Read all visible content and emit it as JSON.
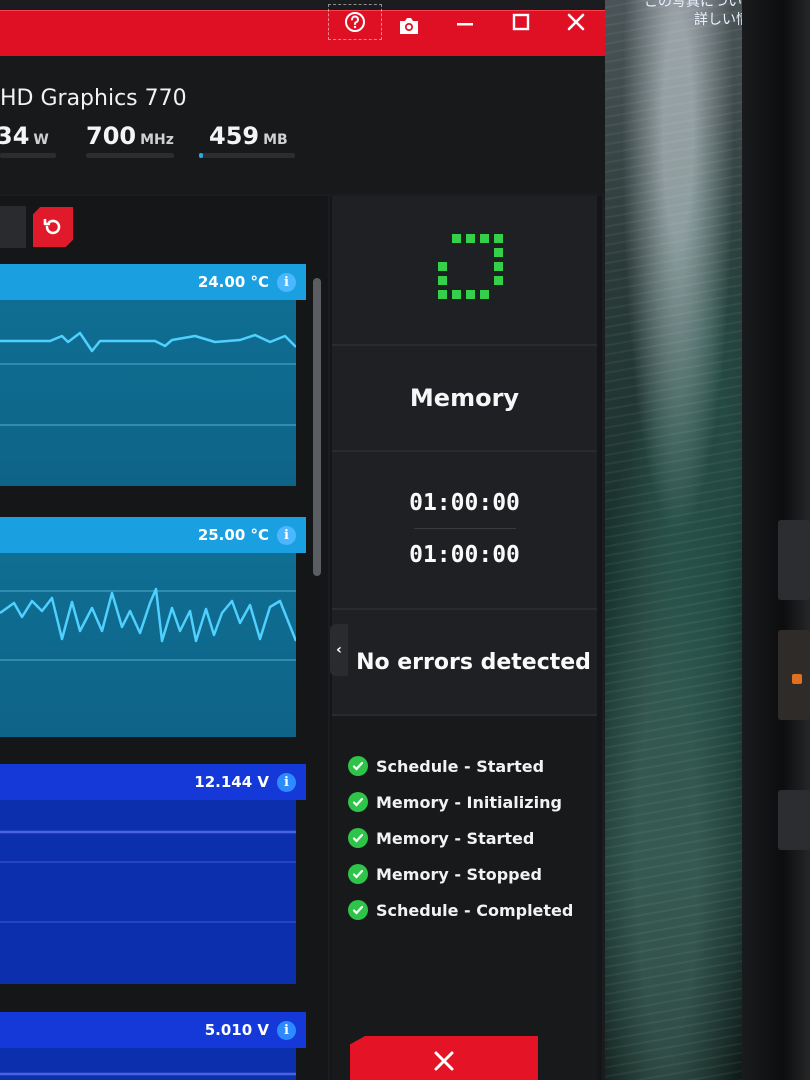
{
  "desktop": {
    "note_line1": "この写真についての",
    "note_line2": "詳しい情報"
  },
  "titlebar": {
    "help_icon": "question-circle-icon",
    "camera_icon": "camera-icon",
    "minimize_icon": "minimize-icon",
    "maximize_icon": "maximize-icon",
    "close_icon": "close-icon",
    "accent": "#e01024"
  },
  "header": {
    "gpu_name": "HD Graphics 770",
    "stats": [
      {
        "value": "34",
        "unit": "W"
      },
      {
        "value": "700",
        "unit": "MHz"
      },
      {
        "value": "459",
        "unit": "MB"
      }
    ]
  },
  "toolbar": {
    "reset_icon": "reset-icon"
  },
  "sensors": [
    {
      "reading": "24.00 °C",
      "kind": "temperature",
      "color": "#1aa0e0"
    },
    {
      "reading": "25.00 °C",
      "kind": "temperature",
      "color": "#1aa0e0"
    },
    {
      "reading": "12.144 V",
      "kind": "voltage",
      "color": "#1439d8"
    },
    {
      "reading": "5.010 V",
      "kind": "voltage",
      "color": "#1439d8"
    }
  ],
  "sidebar": {
    "test_icon": "memory-test-icon",
    "test_title": "Memory",
    "time_elapsed": "01:00:00",
    "time_total": "01:00:00",
    "status": "No errors detected",
    "collapse_icon": "chevron-left-icon",
    "log": [
      "Schedule - Started",
      "Memory - Initializing",
      "Memory - Started",
      "Memory - Stopped",
      "Schedule - Completed"
    ],
    "stop_icon": "close-icon",
    "success_color": "#2ec44a"
  }
}
